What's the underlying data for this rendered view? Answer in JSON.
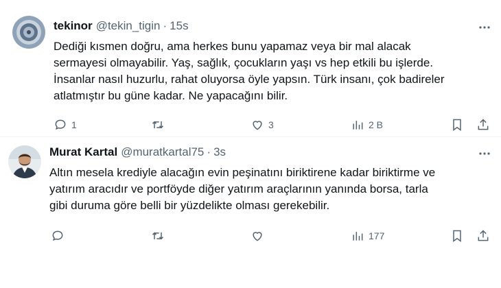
{
  "tweets": [
    {
      "name": "tekinor",
      "handle": "@tekin_tigin",
      "separator": "·",
      "time": "15s",
      "text": "Dediği kısmen doğru, ama herkes bunu yapamaz veya bir mal alacak\nsermayesi olmayabilir. Yaş, sağlık, çocukların yaşı vs hep etkili bu işlerde.\nİnsanlar nasıl huzurlu, rahat oluyorsa öyle yapsın. Türk insanı, çok badireler\natlatmıştır bu güne kadar. Ne yapacağını bilir.",
      "replies": "1",
      "retweets": "",
      "likes": "3",
      "views": "2 B"
    },
    {
      "name": "Murat Kartal",
      "handle": "@muratkartal75",
      "separator": "·",
      "time": "3s",
      "text": "Altın mesela krediyle alacağın evin peşinatını biriktirene kadar biriktirme ve\nyatırım aracıdır ve portföyde diğer yatırım araçlarının yanında borsa, tarla\ngibi duruma göre belli bir yüzdelikte olması gerekebilir.",
      "replies": "",
      "retweets": "",
      "likes": "",
      "views": "177"
    }
  ],
  "colors": {
    "text": "#0f1419",
    "secondary": "#536471",
    "divider": "#eff3f4"
  },
  "icons": [
    "more-icon",
    "reply-icon",
    "retweet-icon",
    "like-icon",
    "views-icon",
    "bookmark-icon",
    "share-icon"
  ]
}
